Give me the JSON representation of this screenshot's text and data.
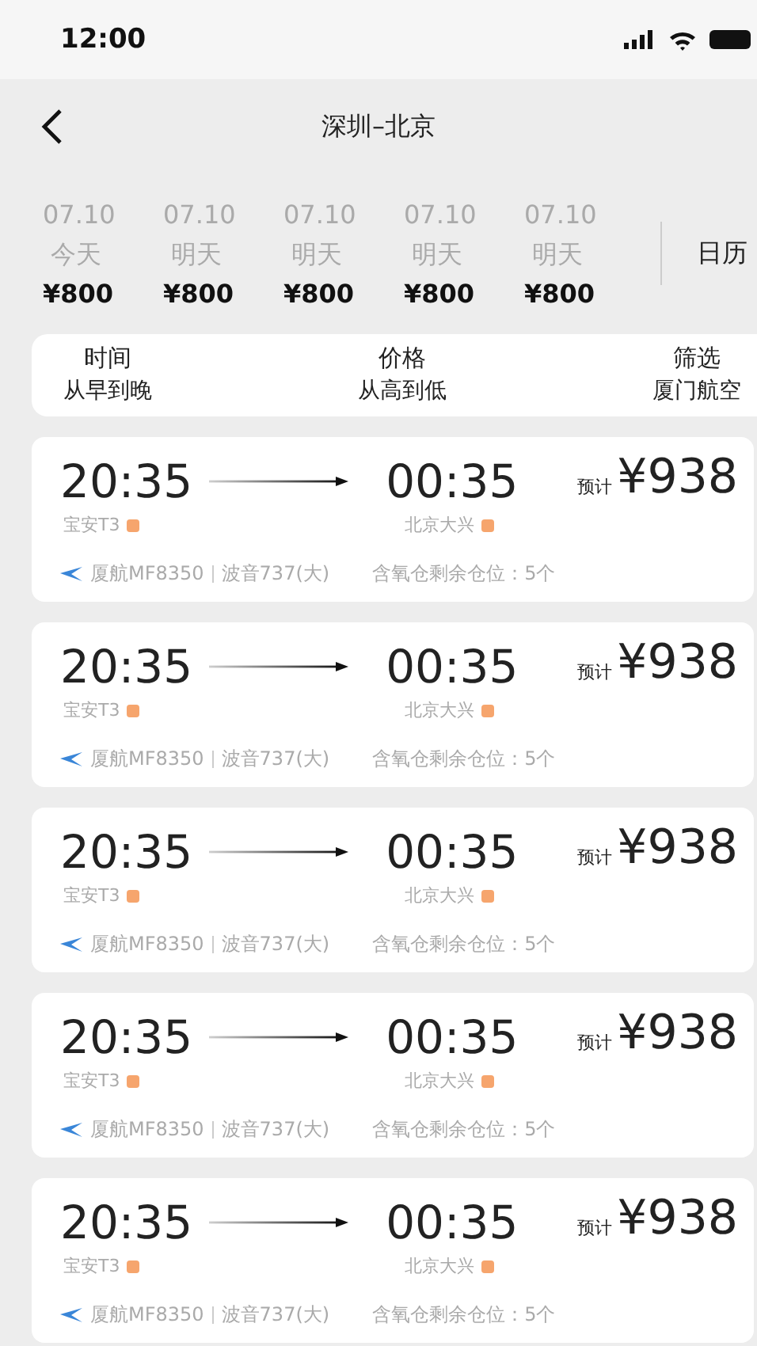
{
  "status_bar": {
    "time": "12:00"
  },
  "nav": {
    "title": "深圳–北京"
  },
  "dates": [
    {
      "date": "07.10",
      "day": "今天",
      "price": "¥800"
    },
    {
      "date": "07.10",
      "day": "明天",
      "price": "¥800"
    },
    {
      "date": "07.10",
      "day": "明天",
      "price": "¥800"
    },
    {
      "date": "07.10",
      "day": "明天",
      "price": "¥800"
    },
    {
      "date": "07.10",
      "day": "明天",
      "price": "¥800"
    }
  ],
  "calendar_label": "日历",
  "sort_options": [
    {
      "title": "时间",
      "value": "从早到晚"
    },
    {
      "title": "价格",
      "value": "从高到低"
    },
    {
      "title": "筛选",
      "value": "厦门航空"
    }
  ],
  "flights": [
    {
      "depart_time": "20:35",
      "depart_airport": "宝安T3",
      "arrive_time": "00:35",
      "arrive_airport": "北京大兴",
      "price_label": "预计",
      "price": "¥938",
      "flight_no": "厦航MF8350",
      "aircraft": "波音737(大)",
      "seats": "含氧仓剩余仓位：5个"
    },
    {
      "depart_time": "20:35",
      "depart_airport": "宝安T3",
      "arrive_time": "00:35",
      "arrive_airport": "北京大兴",
      "price_label": "预计",
      "price": "¥938",
      "flight_no": "厦航MF8350",
      "aircraft": "波音737(大)",
      "seats": "含氧仓剩余仓位：5个"
    },
    {
      "depart_time": "20:35",
      "depart_airport": "宝安T3",
      "arrive_time": "00:35",
      "arrive_airport": "北京大兴",
      "price_label": "预计",
      "price": "¥938",
      "flight_no": "厦航MF8350",
      "aircraft": "波音737(大)",
      "seats": "含氧仓剩余仓位：5个"
    },
    {
      "depart_time": "20:35",
      "depart_airport": "宝安T3",
      "arrive_time": "00:35",
      "arrive_airport": "北京大兴",
      "price_label": "预计",
      "price": "¥938",
      "flight_no": "厦航MF8350",
      "aircraft": "波音737(大)",
      "seats": "含氧仓剩余仓位：5个"
    },
    {
      "depart_time": "20:35",
      "depart_airport": "宝安T3",
      "arrive_time": "00:35",
      "arrive_airport": "北京大兴",
      "price_label": "预计",
      "price": "¥938",
      "flight_no": "厦航MF8350",
      "aircraft": "波音737(大)",
      "seats": "含氧仓剩余仓位：5个"
    }
  ]
}
